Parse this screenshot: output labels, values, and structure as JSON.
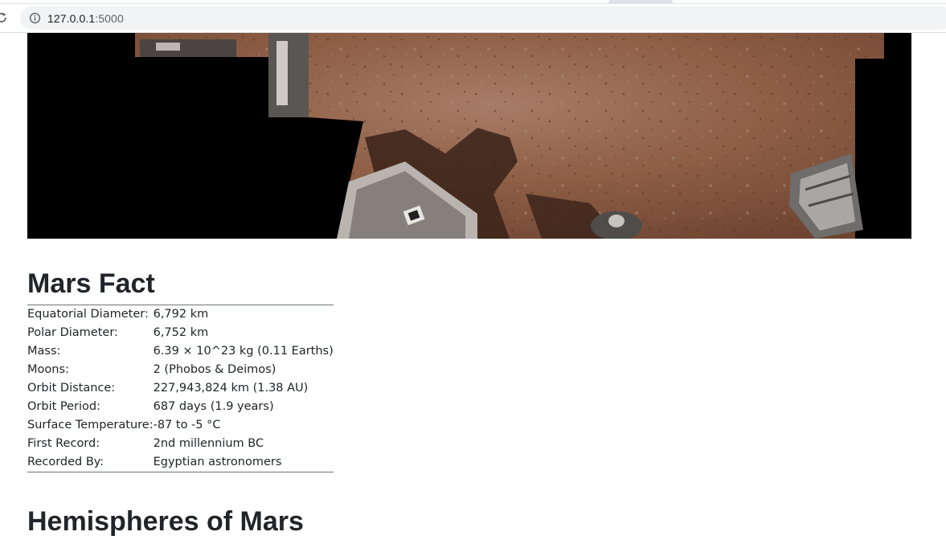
{
  "browser": {
    "url_host": "127.0.0.1",
    "url_port": ":5000"
  },
  "hero": {
    "icons": [
      "reload-icon",
      "info-icon"
    ],
    "ground_color": "#8a5a41"
  },
  "facts": {
    "title": "Mars Fact",
    "rows": [
      {
        "label": "Equatorial Diameter:",
        "value": "6,792 km"
      },
      {
        "label": "Polar Diameter:",
        "value": "6,752 km"
      },
      {
        "label": "Mass:",
        "value": "6.39 × 10^23 kg (0.11 Earths)"
      },
      {
        "label": "Moons:",
        "value": "2 (Phobos & Deimos)"
      },
      {
        "label": "Orbit Distance:",
        "value": "227,943,824 km (1.38 AU)"
      },
      {
        "label": "Orbit Period:",
        "value": "687 days (1.9 years)"
      },
      {
        "label": "Surface Temperature:",
        "value": "-87 to -5 °C"
      },
      {
        "label": "First Record:",
        "value": "2nd millennium BC"
      },
      {
        "label": "Recorded By:",
        "value": "Egyptian astronomers"
      }
    ]
  },
  "hemispheres": {
    "title": "Hemispheres of Mars"
  }
}
